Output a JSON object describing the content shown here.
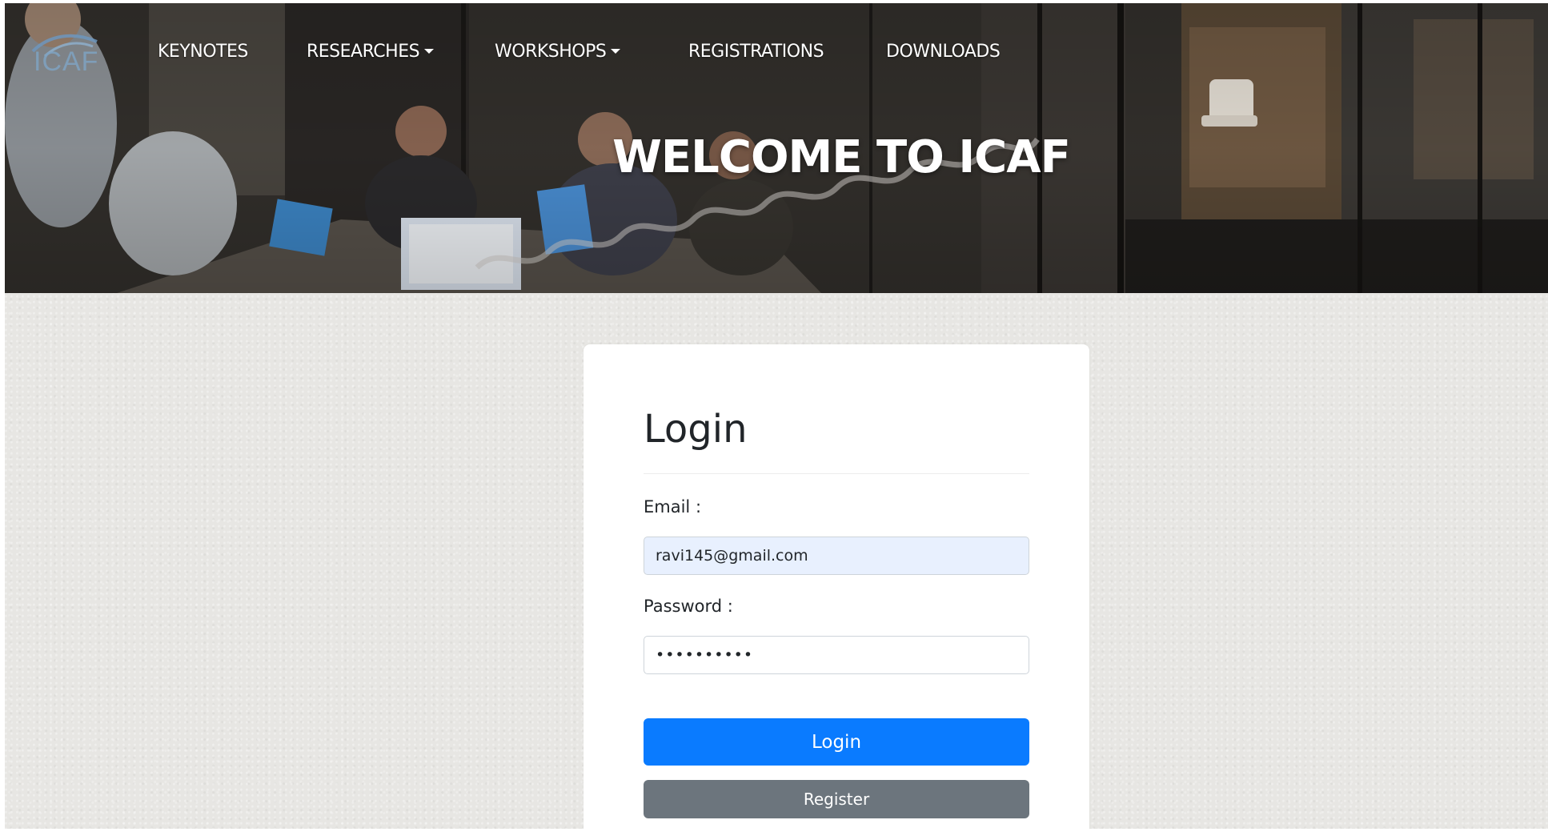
{
  "header": {
    "logo_text": "ICAF",
    "title": "WELCOME TO ICAF",
    "nav": [
      {
        "label": "KEYNOTES",
        "dropdown": false
      },
      {
        "label": "RESEARCHES",
        "dropdown": true
      },
      {
        "label": "WORKSHOPS",
        "dropdown": true
      },
      {
        "label": "REGISTRATIONS",
        "dropdown": false
      },
      {
        "label": "DOWNLOADS",
        "dropdown": false
      }
    ]
  },
  "login": {
    "title": "Login",
    "email_label": "Email :",
    "email_value": "ravi145@gmail.com",
    "password_label": "Password :",
    "password_value": "••••••••••",
    "login_button": "Login",
    "register_button": "Register"
  },
  "colors": {
    "primary": "#0a7bff",
    "secondary": "#6c757d",
    "autofill": "#e8f0fe",
    "page_background": "#e7e6e3"
  }
}
